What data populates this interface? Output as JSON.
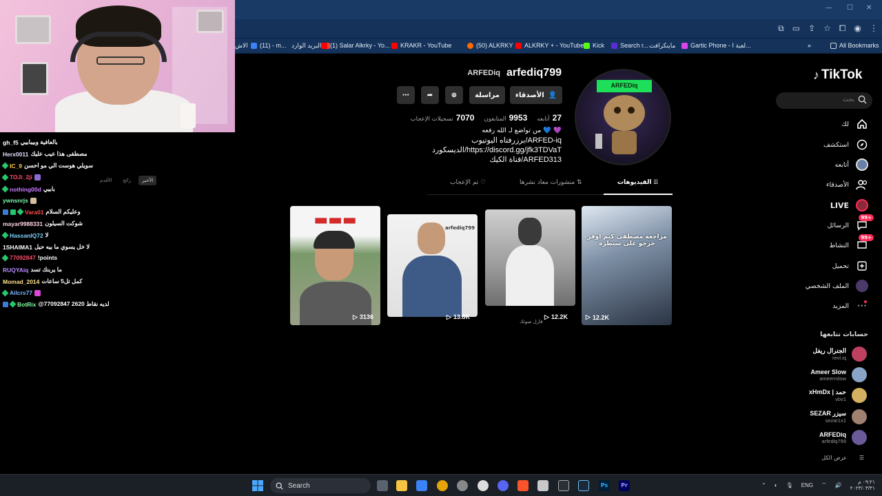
{
  "browser": {
    "bookmarks": [
      {
        "label": "الاش",
        "color": "#e44"
      },
      {
        "label": "(11) - m...",
        "color": "#3b82f6"
      },
      {
        "label": "البريد الوارد",
        "color": "#ea4335"
      },
      {
        "label": "(1) Salar Alkrky - Yo...",
        "color": "#ff0000"
      },
      {
        "label": "KRAKR - YouTube",
        "color": "#ff0000"
      },
      {
        "label": "(50) ALKRKY",
        "color": "#ff6a00"
      },
      {
        "label": "ALKRKY + - YouTube",
        "color": "#ff0000"
      },
      {
        "label": "Kick",
        "color": "#53fc18"
      },
      {
        "label": "Search r...",
        "color": "#5b2bd6"
      },
      {
        "label": "ماينكرافت",
        "color": "#3b82f6"
      },
      {
        "label": "Gartic Phone - لعبة ا...",
        "color": "#d946ef"
      }
    ],
    "all_bookmarks": "All Bookmarks"
  },
  "chat": {
    "messages": [
      {
        "user": "gh_f5",
        "color": "#ffffff",
        "text": "بالعافية وبيبابيي",
        "badge": "none"
      },
      {
        "user": "Herx0011",
        "color": "#e0e0ff",
        "text": "مصطفى هذا عيب عليك",
        "badge": "none"
      },
      {
        "user": "IC_9",
        "color": "#ffd24a",
        "text": "سويلي هوست الي مو احسن",
        "badge": "diamond"
      },
      {
        "user": "TOJi_2ji",
        "color": "#ff4d6a",
        "text": "",
        "badge": "diamond"
      },
      {
        "user": "nothing00d",
        "color": "#c87dff",
        "text": "بابيي",
        "badge": "diamond"
      },
      {
        "user": "ywnsnrjs",
        "color": "#7dffb0",
        "text": "",
        "badge": "none"
      },
      {
        "user": "Vara01",
        "color": "#ff4d4d",
        "text": "وعليكم السلام",
        "badge": "multi"
      },
      {
        "user": "mayar9988331",
        "color": "#ffd6e6",
        "text": "شوكت السيلون",
        "badge": "none"
      },
      {
        "user": "HassanIQ72",
        "color": "#7dd3ff",
        "text": "لا",
        "badge": "diamond"
      },
      {
        "user": "1SHAIMA1",
        "color": "#ffffff",
        "text": "لا خل يسوي ما بيه حيل",
        "badge": "none"
      },
      {
        "user": "77092847",
        "color": "#ff4d6a",
        "text": "!points",
        "badge": "diamond"
      },
      {
        "user": "RUQYAiq",
        "color": "#b88cff",
        "text": "ما يربنك تسد",
        "badge": "none"
      },
      {
        "user": "Momad_2014",
        "color": "#ffe08a",
        "text": "كمل تل5 ساعات",
        "badge": "none"
      },
      {
        "user": "Ailcrs77",
        "color": "#7db7ff",
        "text": "",
        "badge": "diamond"
      },
      {
        "user": "BotRix",
        "color": "#7dff9d",
        "text": "@77092847 2620 لديه نقاط",
        "badge": "bot"
      }
    ],
    "filters": [
      "الأخير",
      "رائج",
      "الأقدم"
    ]
  },
  "tiktok": {
    "logo": "TikTok",
    "search_placeholder": "بحث",
    "nav": [
      {
        "label": "لك",
        "icon": "home-icon"
      },
      {
        "label": "استكشف",
        "icon": "explore-icon"
      },
      {
        "label": "أتابعه",
        "icon": "following-icon"
      },
      {
        "label": "الأصدقاء",
        "icon": "friends-icon"
      },
      {
        "label": "LIVE",
        "icon": "live-icon"
      },
      {
        "label": "الرسائل",
        "icon": "messages-icon",
        "badge": "99+"
      },
      {
        "label": "النشاط",
        "icon": "activity-icon",
        "badge": "99+"
      },
      {
        "label": "تحميل",
        "icon": "upload-icon"
      },
      {
        "label": "الملف الشخصي",
        "icon": "profile-icon"
      },
      {
        "label": "المزيد",
        "icon": "more-icon"
      }
    ],
    "following_title": "حسابات تتابعها",
    "following": [
      {
        "name": "الجنرال ريفل",
        "handle": "revl.iq",
        "color": "#c04060"
      },
      {
        "name": "Ameer Slow",
        "handle": "ameerrslow",
        "color": "#8aa4c8"
      },
      {
        "name": "xHmDx | حمد",
        "handle": "vbv1",
        "color": "#d4b060"
      },
      {
        "name": "SEZAR سيزر",
        "handle": "sezar1x1",
        "color": "#a08070"
      },
      {
        "name": "ARFEDiq",
        "handle": "arfediq799",
        "color": "#6a5a9a"
      }
    ],
    "see_all": "عرض الكل",
    "profile": {
      "username": "arfediq799",
      "nickname": "ARFEDiq",
      "avatar_text": "ARFEDiq",
      "friends_button": "الأصدقاء",
      "message_button": "مراسلة",
      "stats": [
        {
          "value": "27",
          "label": "أتابعه"
        },
        {
          "value": "9953",
          "label": "المتابعون"
        },
        {
          "value": "7070",
          "label": "تسجيلات الإعجاب"
        }
      ],
      "bio": [
        "من تواضع لـ الله رفعه 💙 💜",
        "برزرفتاه اليوتيوب/ARFED-iq",
        "الديسكورد/https://discord.gg/jfk3TDVaT",
        "قناة الكيك/ARFED313"
      ],
      "tabs": [
        {
          "label": "الفيديوهات",
          "active": true
        },
        {
          "label": "منشورات معاد نشرها",
          "active": false
        },
        {
          "label": "تم الإعجاب",
          "active": false
        }
      ],
      "videos": [
        {
          "views": "12.2K",
          "caption": "مراجعة مصطفى كيم اوفر خرجو على سيطرة"
        },
        {
          "views": "12.2K",
          "caption": "فارل صوتك"
        },
        {
          "views": "13.8K",
          "caption": "arfediq799"
        },
        {
          "views": "3136",
          "caption": ""
        }
      ]
    }
  },
  "taskbar": {
    "search": "Search",
    "lang": "ENG",
    "time": "٠٩:٢١ م",
    "date": "٢٠٢٣/٠٣/٣١"
  }
}
